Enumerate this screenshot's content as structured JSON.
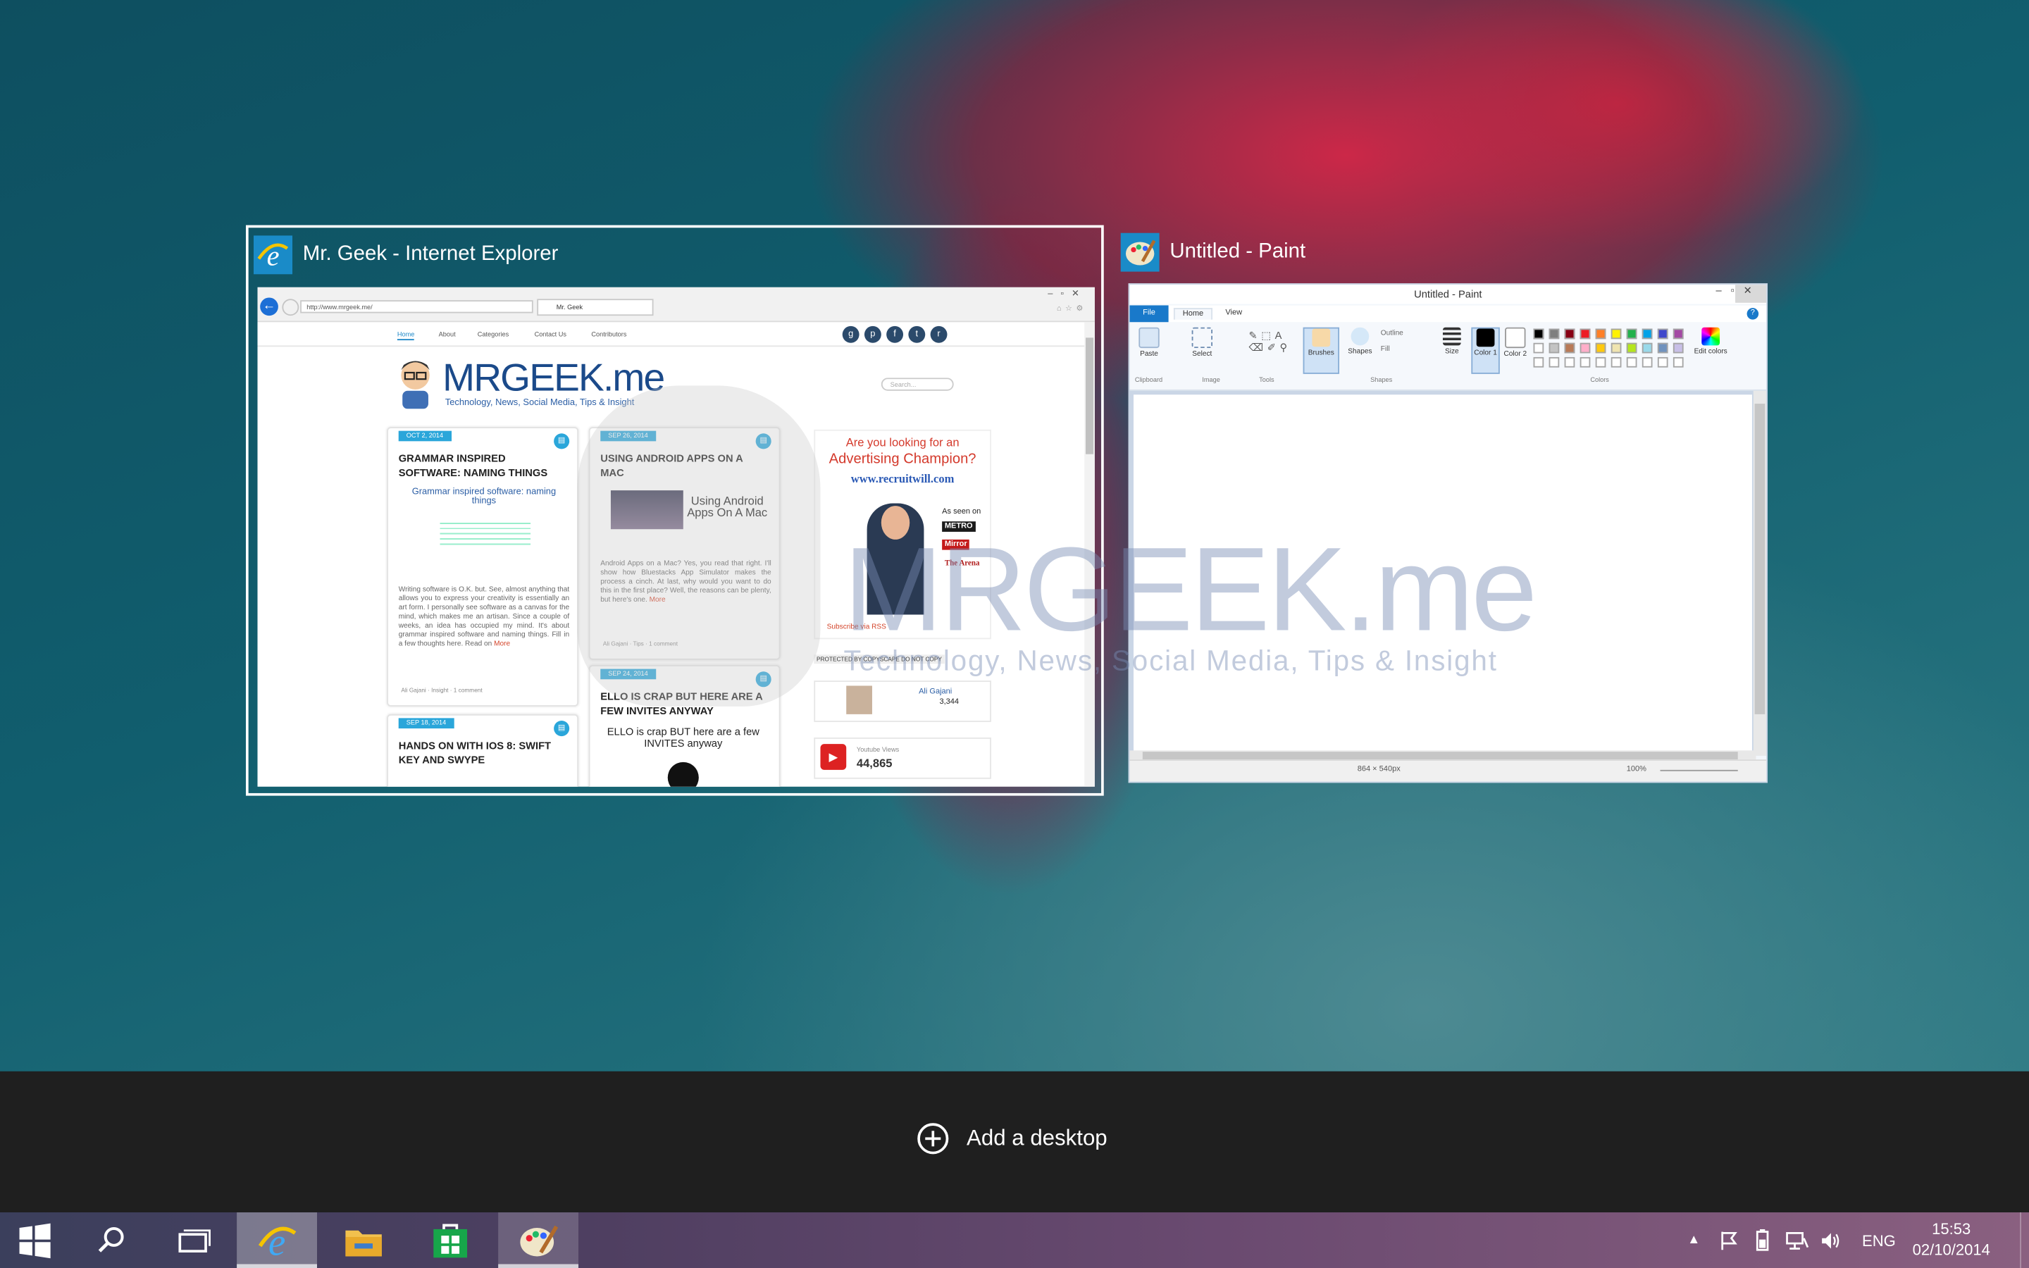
{
  "task_view": {
    "windows": [
      {
        "title": "Mr. Geek - Internet Explorer",
        "app": "internet-explorer",
        "selected": true,
        "browser": {
          "address": "http://www.mrgeek.me/",
          "tab_title": "Mr. Geek",
          "site": {
            "nav": [
              "Home",
              "About",
              "Categories",
              "Contact Us",
              "Contributors"
            ],
            "logo_text": "MRGEEK.me",
            "tagline": "Technology, News, Social Media, Tips & Insight",
            "search_placeholder": "Search...",
            "posts": [
              {
                "date": "OCT 2, 2014",
                "title": "GRAMMAR INSPIRED SOFTWARE: NAMING THINGS",
                "image_text": "Grammar inspired software: naming things",
                "excerpt": "Writing software is O.K. but. See, almost anything that allows you to express your creativity is essentially an art form. I personally see software as a canvas for the mind, which makes me an artisan. Since a couple of weeks, an idea has occupied my mind. It's about grammar inspired software and naming things. Fill in a few thoughts here. Read on",
                "more": "More",
                "meta": "Ali Gajani · Insight · 1 comment"
              },
              {
                "date": "SEP 26, 2014",
                "title": "USING ANDROID APPS ON A MAC",
                "image_text": "Using Android Apps On A Mac",
                "excerpt": "Android Apps on a Mac? Yes, you read that right. I'll show how Bluestacks App Simulator makes the process a cinch. At last, why would you want to do this in the first place? Well, the reasons can be plenty, but here's one.",
                "more": "More",
                "meta": "Ali Gajani · Tips · 1 comment"
              },
              {
                "date": "SEP 24, 2014",
                "title": "ELLO IS CRAP BUT HERE ARE A FEW INVITES ANYWAY",
                "image_text": "ELLO is crap BUT here are a few INVITES anyway"
              },
              {
                "date": "SEP 18, 2014",
                "title": "HANDS ON WITH IOS 8: SWIFT KEY AND SWYPE"
              }
            ],
            "ad": {
              "line1": "Are you looking for an",
              "line2": "Advertising Champion?",
              "url": "www.recruitwill.com",
              "as_seen_on": "As seen on",
              "press": [
                "METRO",
                "Mirror",
                "The Arena"
              ]
            },
            "subscribe": "Subscribe via RSS",
            "protected": "PROTECTED BY COPYSCAPE DO NOT COPY",
            "author": {
              "name": "Ali Gajani",
              "count": "3,344"
            },
            "youtube": {
              "label": "Youtube Views",
              "count": "44,865"
            }
          }
        }
      },
      {
        "title": "Untitled - Paint",
        "app": "paint",
        "selected": false,
        "paint": {
          "window_title": "Untitled - Paint",
          "menus": [
            "File",
            "Home",
            "View"
          ],
          "groups": [
            "Clipboard",
            "Image",
            "Tools",
            "Colors"
          ],
          "buttons": {
            "paste": "Paste",
            "select": "Select",
            "brushes": "Brushes",
            "shapes": "Shapes",
            "outline": "Outline",
            "fill": "Fill",
            "size": "Size",
            "color1": "Color 1",
            "color2": "Color 2",
            "edit_colors": "Edit colors"
          },
          "status": {
            "dimensions": "864 × 540px",
            "zoom": "100%"
          }
        }
      }
    ],
    "watermark": {
      "word": "MRGEEK.me",
      "tagline": "Technology, News, Social Media, Tips & Insight"
    },
    "add_desktop_label": "Add a desktop"
  },
  "taskbar": {
    "buttons": [
      {
        "name": "start",
        "icon": "windows-logo-icon"
      },
      {
        "name": "search",
        "icon": "search-icon"
      },
      {
        "name": "task-view",
        "icon": "task-view-icon"
      },
      {
        "name": "internet-explorer",
        "icon": "internet-explorer-icon"
      },
      {
        "name": "file-explorer",
        "icon": "folder-icon"
      },
      {
        "name": "store",
        "icon": "store-icon"
      },
      {
        "name": "paint",
        "icon": "paint-icon"
      }
    ],
    "tray": {
      "language": "ENG",
      "time": "15:53",
      "date": "02/10/2014"
    }
  },
  "colors": {
    "accent": "#1979ca",
    "desk_bar": "#1f1f1f",
    "ie_blue": "#1d6fd6"
  }
}
